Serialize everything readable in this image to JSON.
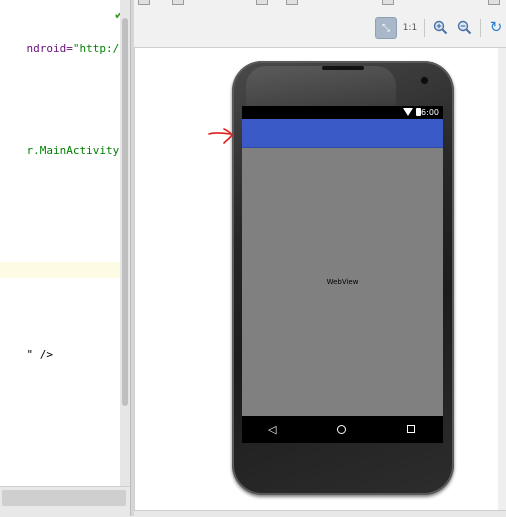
{
  "editor": {
    "lines": [
      {
        "parts": [
          {
            "t": "ndroid=",
            "c": "attr"
          },
          {
            "t": "\"http://sche",
            "c": "val"
          }
        ]
      },
      {
        "parts": [
          {
            "t": "r.MainActivity\"",
            "c": "val"
          },
          {
            "t": ">",
            "c": "txt"
          }
        ]
      },
      {
        "parts": [
          {
            "t": "\" />",
            "c": "txt"
          }
        ]
      }
    ]
  },
  "preview": {
    "toolbar": {
      "fit_icon": "fit-screen-icon",
      "actual_size_label": "1:1",
      "zoom_in_icon": "zoom-in-icon",
      "zoom_out_icon": "zoom-out-icon",
      "refresh_icon": "refresh-icon"
    },
    "device": {
      "status_time": "6:00",
      "webview_label": "WebView",
      "action_bar_color": "#3a5bc7",
      "annotation_color": "#e0201b"
    }
  }
}
